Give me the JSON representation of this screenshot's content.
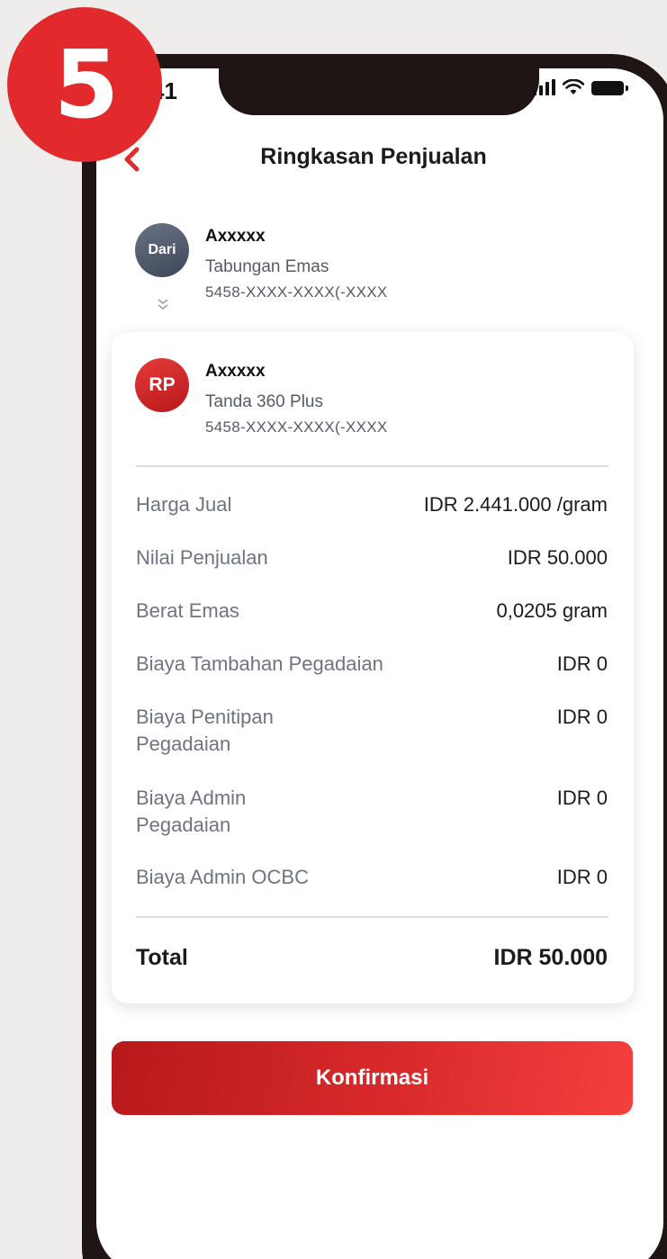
{
  "step": {
    "number": "5"
  },
  "status_bar": {
    "time": "41"
  },
  "header": {
    "title": "Ringkasan Penjualan",
    "back_icon": "chevron-left-icon"
  },
  "from_account": {
    "avatar_label": "Dari",
    "name": "Axxxxx",
    "type": "Tabungan Emas",
    "number": "5458-XXXX-XXXX(-XXXX"
  },
  "to_account": {
    "avatar_label": "RP",
    "name": "Axxxxx",
    "type": "Tanda 360 Plus",
    "number": "5458-XXXX-XXXX(-XXXX"
  },
  "summary": {
    "rows": [
      {
        "label": "Harga Jual",
        "value": "IDR 2.441.000 /gram"
      },
      {
        "label": "Nilai Penjualan",
        "value": "IDR 50.000"
      },
      {
        "label": "Berat Emas",
        "value": "0,0205 gram"
      },
      {
        "label": "Biaya Tambahan Pegadaian",
        "value": "IDR 0"
      },
      {
        "label": "Biaya Penitipan Pegadaian",
        "value": "IDR 0"
      },
      {
        "label": "Biaya Admin Pegadaian",
        "value": "IDR 0"
      },
      {
        "label": "Biaya Admin OCBC",
        "value": "IDR 0"
      }
    ],
    "total_label": "Total",
    "total_value": "IDR 50.000"
  },
  "actions": {
    "confirm_label": "Konfirmasi"
  },
  "colors": {
    "accent": "#e2292b",
    "text_primary": "#1b1b1b",
    "text_secondary": "#6e7480"
  }
}
